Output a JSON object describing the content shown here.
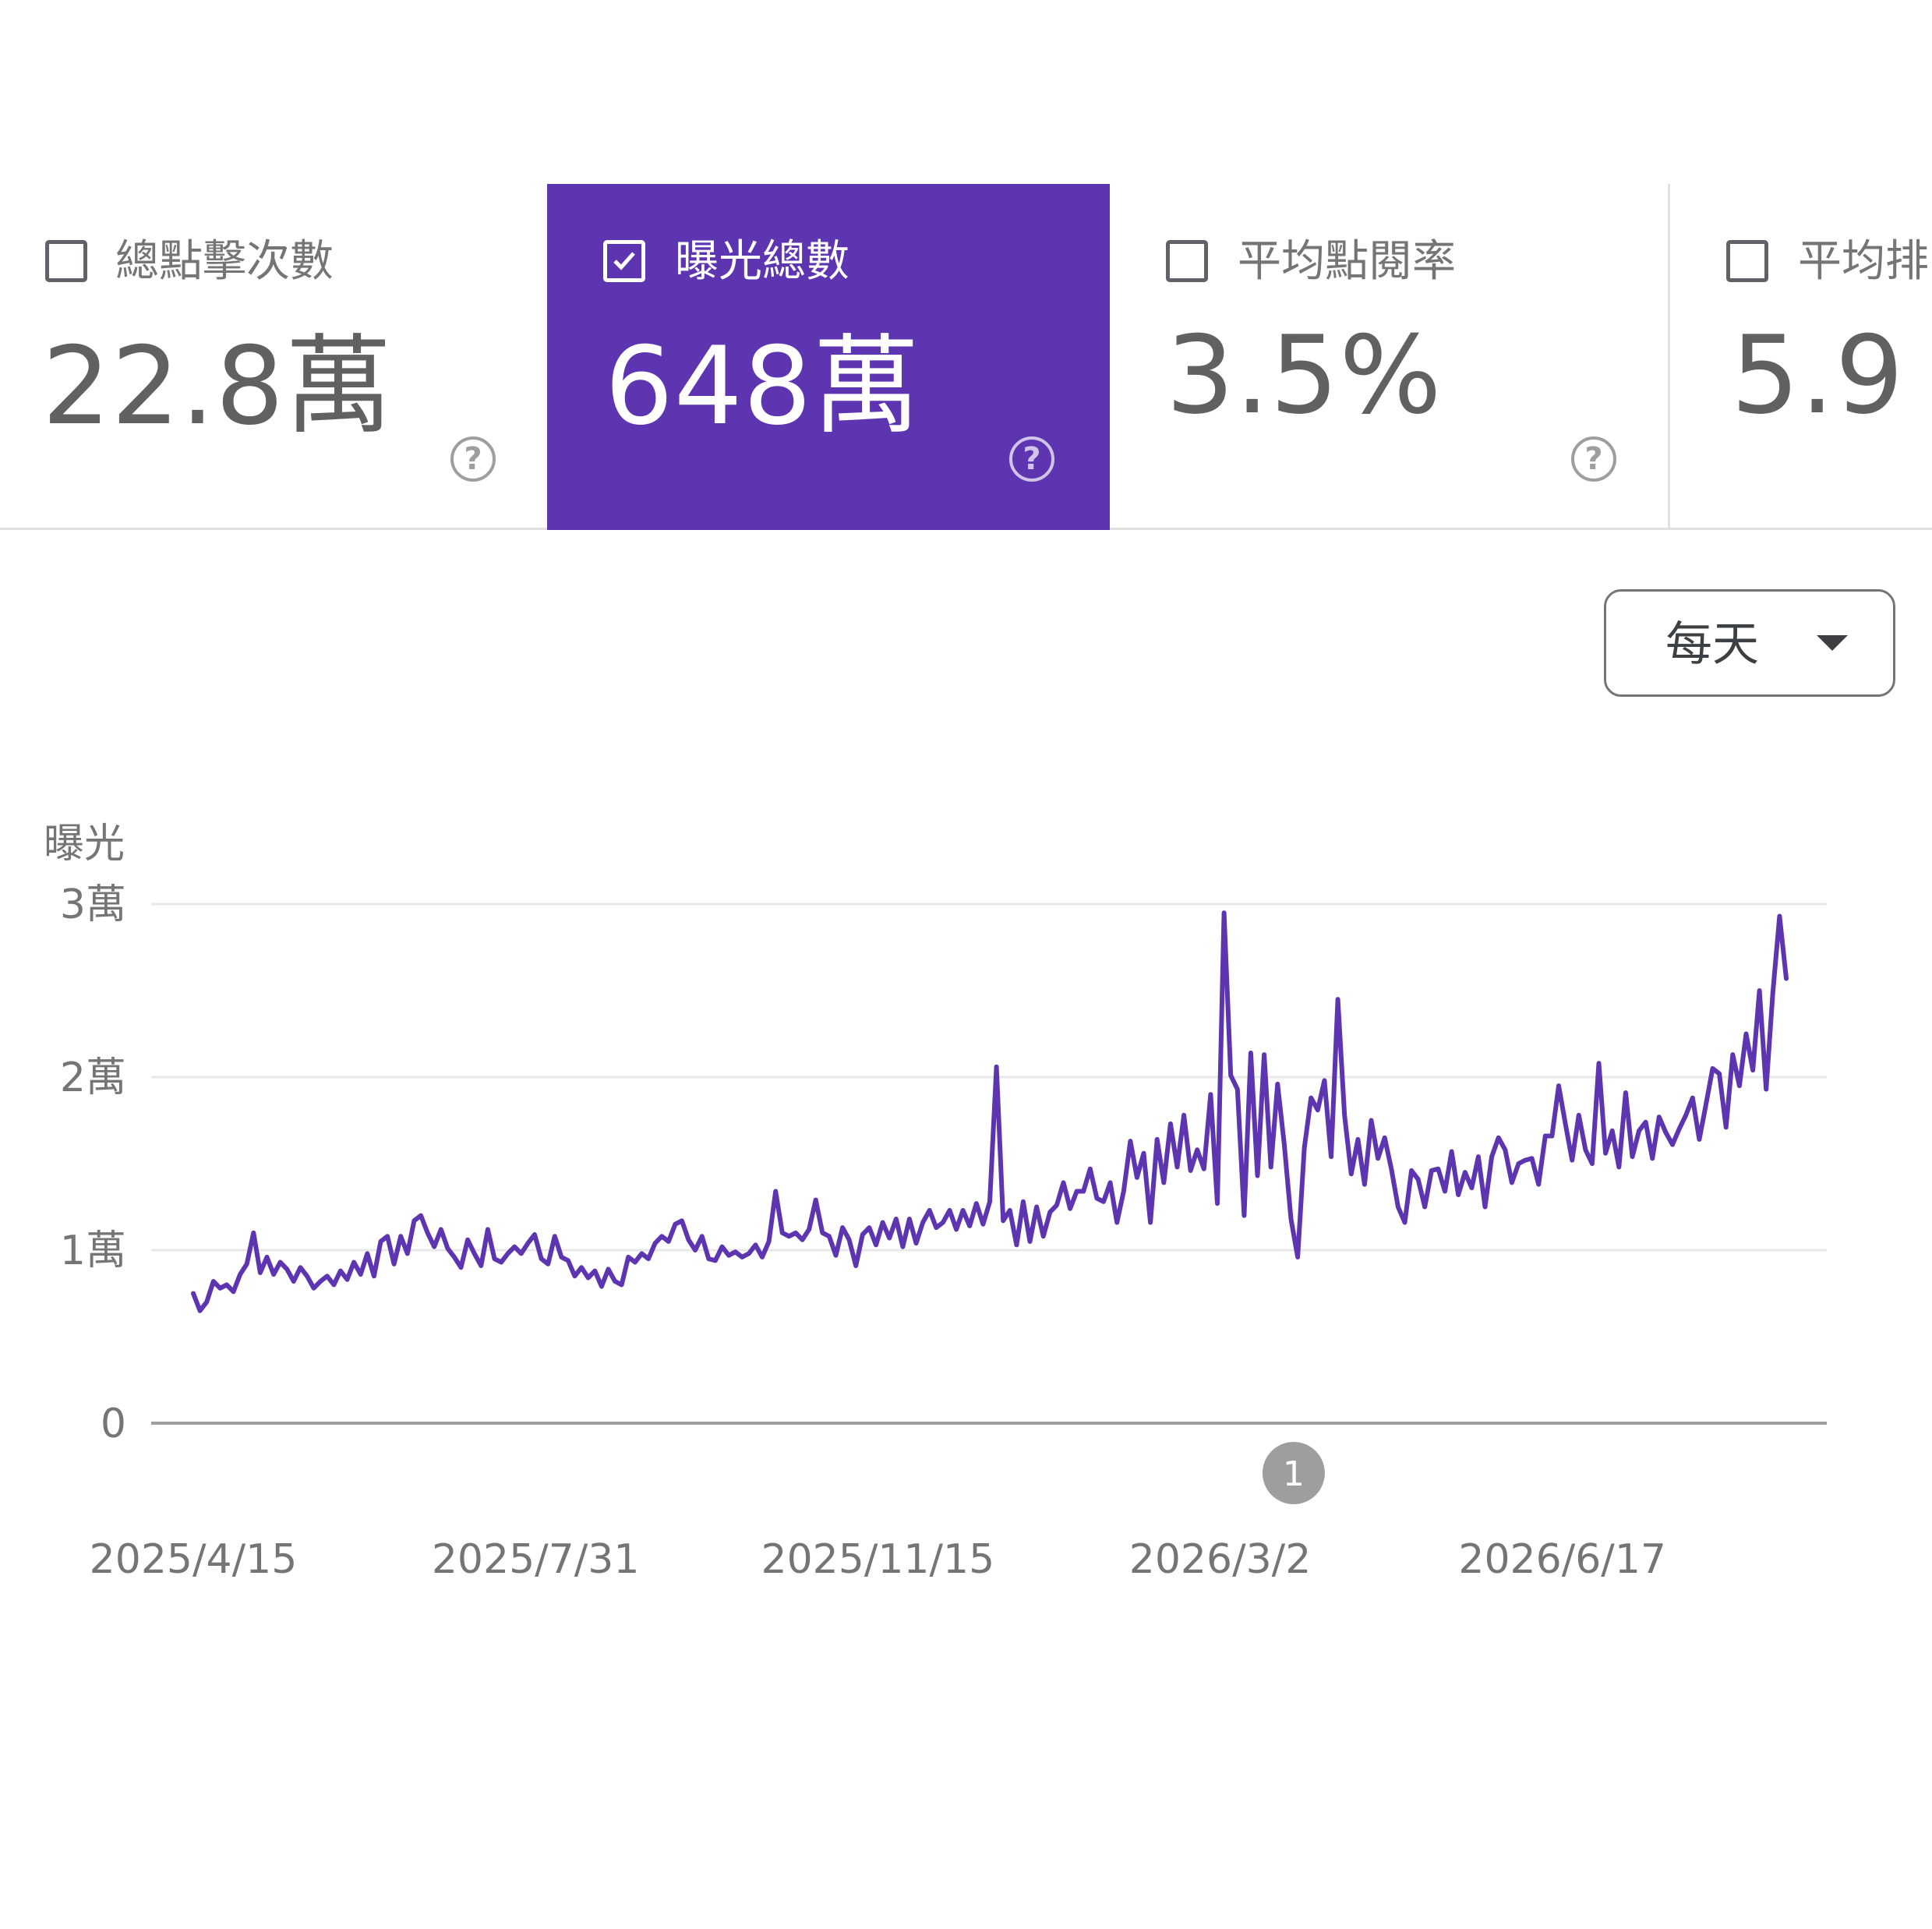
{
  "metrics": [
    {
      "label": "總點擊次數",
      "value": "22.8萬",
      "selected": false
    },
    {
      "label": "曝光總數",
      "value": "648萬",
      "selected": true
    },
    {
      "label": "平均點閱率",
      "value": "3.5%",
      "selected": false
    },
    {
      "label": "平均排",
      "value": "5.9",
      "selected": false
    }
  ],
  "help_glyph": "?",
  "granularity": {
    "label": "每天",
    "icon": "caret-down-icon"
  },
  "annotation": {
    "label": "1",
    "color": "#9e9e9e"
  },
  "colors": {
    "accent": "#5e35b1",
    "line": "#5e35b1"
  },
  "chart_data": {
    "type": "line",
    "ylabel": "曝光",
    "y_ticks": [
      "0",
      "1萬",
      "2萬",
      "3萬"
    ],
    "ylim": [
      0,
      30000
    ],
    "x_ticks": [
      "2025/4/15",
      "2025/7/31",
      "2025/11/15",
      "2026/3/2",
      "2026/6/17"
    ],
    "x_start": "2025-04-15",
    "x_end": "2026-08-26",
    "grid": true,
    "series": [
      {
        "values": [
          7500,
          6500,
          7000,
          8200,
          7800,
          8000,
          7600,
          8600,
          9200,
          11000,
          8700,
          9600,
          8600,
          9300,
          8900,
          8200,
          9000,
          8500,
          7800,
          8200,
          8500,
          8000,
          8800,
          8300,
          9300,
          8600,
          9800,
          8500,
          10500,
          10800,
          9200,
          10800,
          9800,
          11700,
          12000,
          11000,
          10200,
          11200,
          10100,
          9600,
          9000,
          10600,
          9800,
          9100,
          11200,
          9500,
          9300,
          9800,
          10200,
          9800,
          10400,
          10900,
          9500,
          9200,
          10800,
          9600,
          9400,
          8500,
          9000,
          8400,
          8800,
          7900,
          8900,
          8200,
          8000,
          9600,
          9300,
          9800,
          9500,
          10400,
          10800,
          10500,
          11500,
          11700,
          10600,
          10000,
          10800,
          9500,
          9400,
          10200,
          9700,
          9900,
          9600,
          9800,
          10300,
          9600,
          10500,
          13400,
          11000,
          10800,
          11000,
          10600,
          11200,
          12900,
          11000,
          10800,
          9700,
          11300,
          10600,
          9100,
          10900,
          11300,
          10300,
          11600,
          10700,
          11800,
          10200,
          11800,
          10400,
          11600,
          12300,
          11300,
          11600,
          12300,
          11200,
          12300,
          11400,
          12700,
          11500,
          12800,
          20600,
          11700,
          12300,
          10300,
          12800,
          10500,
          12500,
          10800,
          12200,
          12600,
          13900,
          12400,
          13400,
          13400,
          14700,
          13000,
          12800,
          13900,
          11600,
          13400,
          16300,
          14200,
          15600,
          11600,
          16400,
          13900,
          17300,
          14800,
          17800,
          14600,
          15800,
          14700,
          19000,
          12700,
          29500,
          20100,
          19300,
          12000,
          21400,
          14300,
          21300,
          14800,
          19600,
          16100,
          11800,
          9600,
          15900,
          18800,
          18100,
          19800,
          15400,
          24500,
          17800,
          14400,
          16400,
          13800,
          17500,
          15300,
          16500,
          14700,
          12500,
          11600,
          14600,
          14100,
          12500,
          14600,
          14700,
          13400,
          15700,
          13200,
          14500,
          13600,
          15400,
          12500,
          15400,
          16500,
          15800,
          13900,
          15000,
          15200,
          15300,
          13800,
          16600,
          16600,
          19500,
          17300,
          15200,
          17800,
          15800,
          15000,
          20800,
          15600,
          16900,
          14800,
          19100,
          15400,
          16900,
          17400,
          15300,
          17700,
          16800,
          16100,
          17000,
          17800,
          18800,
          16400,
          18400,
          20500,
          20200,
          17100,
          21300,
          19500,
          22500,
          20400,
          25000,
          19300,
          24900,
          29300,
          25700
        ]
      }
    ]
  }
}
